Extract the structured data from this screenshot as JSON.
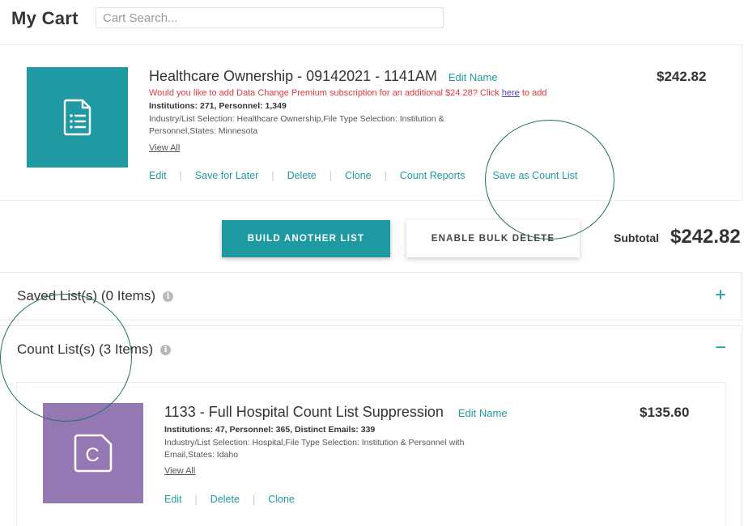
{
  "header": {
    "title": "My Cart",
    "search_placeholder": "Cart Search..."
  },
  "cart_item": {
    "title": "Healthcare Ownership - 09142021 - 1141AM",
    "edit_name": "Edit Name",
    "promo_text": "Would you like to add Data Change Premium subscription for an additional $24.28? Click ",
    "promo_link": "here",
    "promo_suffix": " to add",
    "counts": "Institutions: 271, Personnel: 1,349",
    "details": "Industry/List Selection: Healthcare Ownership,File Type Selection: Institution & Personnel,States: Minnesota",
    "view_all": "View All",
    "price": "$242.82",
    "actions": [
      "Edit",
      "Save for Later",
      "Delete",
      "Clone",
      "Count Reports",
      "Save as Count List"
    ],
    "icon": "document-list-icon"
  },
  "buttons": {
    "build": "BUILD ANOTHER LIST",
    "bulk_delete": "ENABLE BULK DELETE"
  },
  "subtotal": {
    "label": "Subtotal",
    "value": "$242.82"
  },
  "saved_section": {
    "title": "Saved List(s) (0 Items)",
    "toggle": "+"
  },
  "count_section": {
    "title": "Count List(s) (3 Items)",
    "toggle": "−"
  },
  "count_item": {
    "title": "1133 - Full Hospital Count List Suppression",
    "edit_name": "Edit Name",
    "counts": "Institutions: 47, Personnel: 365, Distinct Emails: 339",
    "details": "Industry/List Selection: Hospital,File Type Selection: Institution & Personnel with Email,States: Idaho",
    "view_all": "View All",
    "price": "$135.60",
    "actions": [
      "Edit",
      "Delete",
      "Clone"
    ],
    "icon_letter": "C"
  },
  "colors": {
    "teal": "#1f9aa3",
    "purple": "#9478b4",
    "promo_red": "#e0383e"
  }
}
